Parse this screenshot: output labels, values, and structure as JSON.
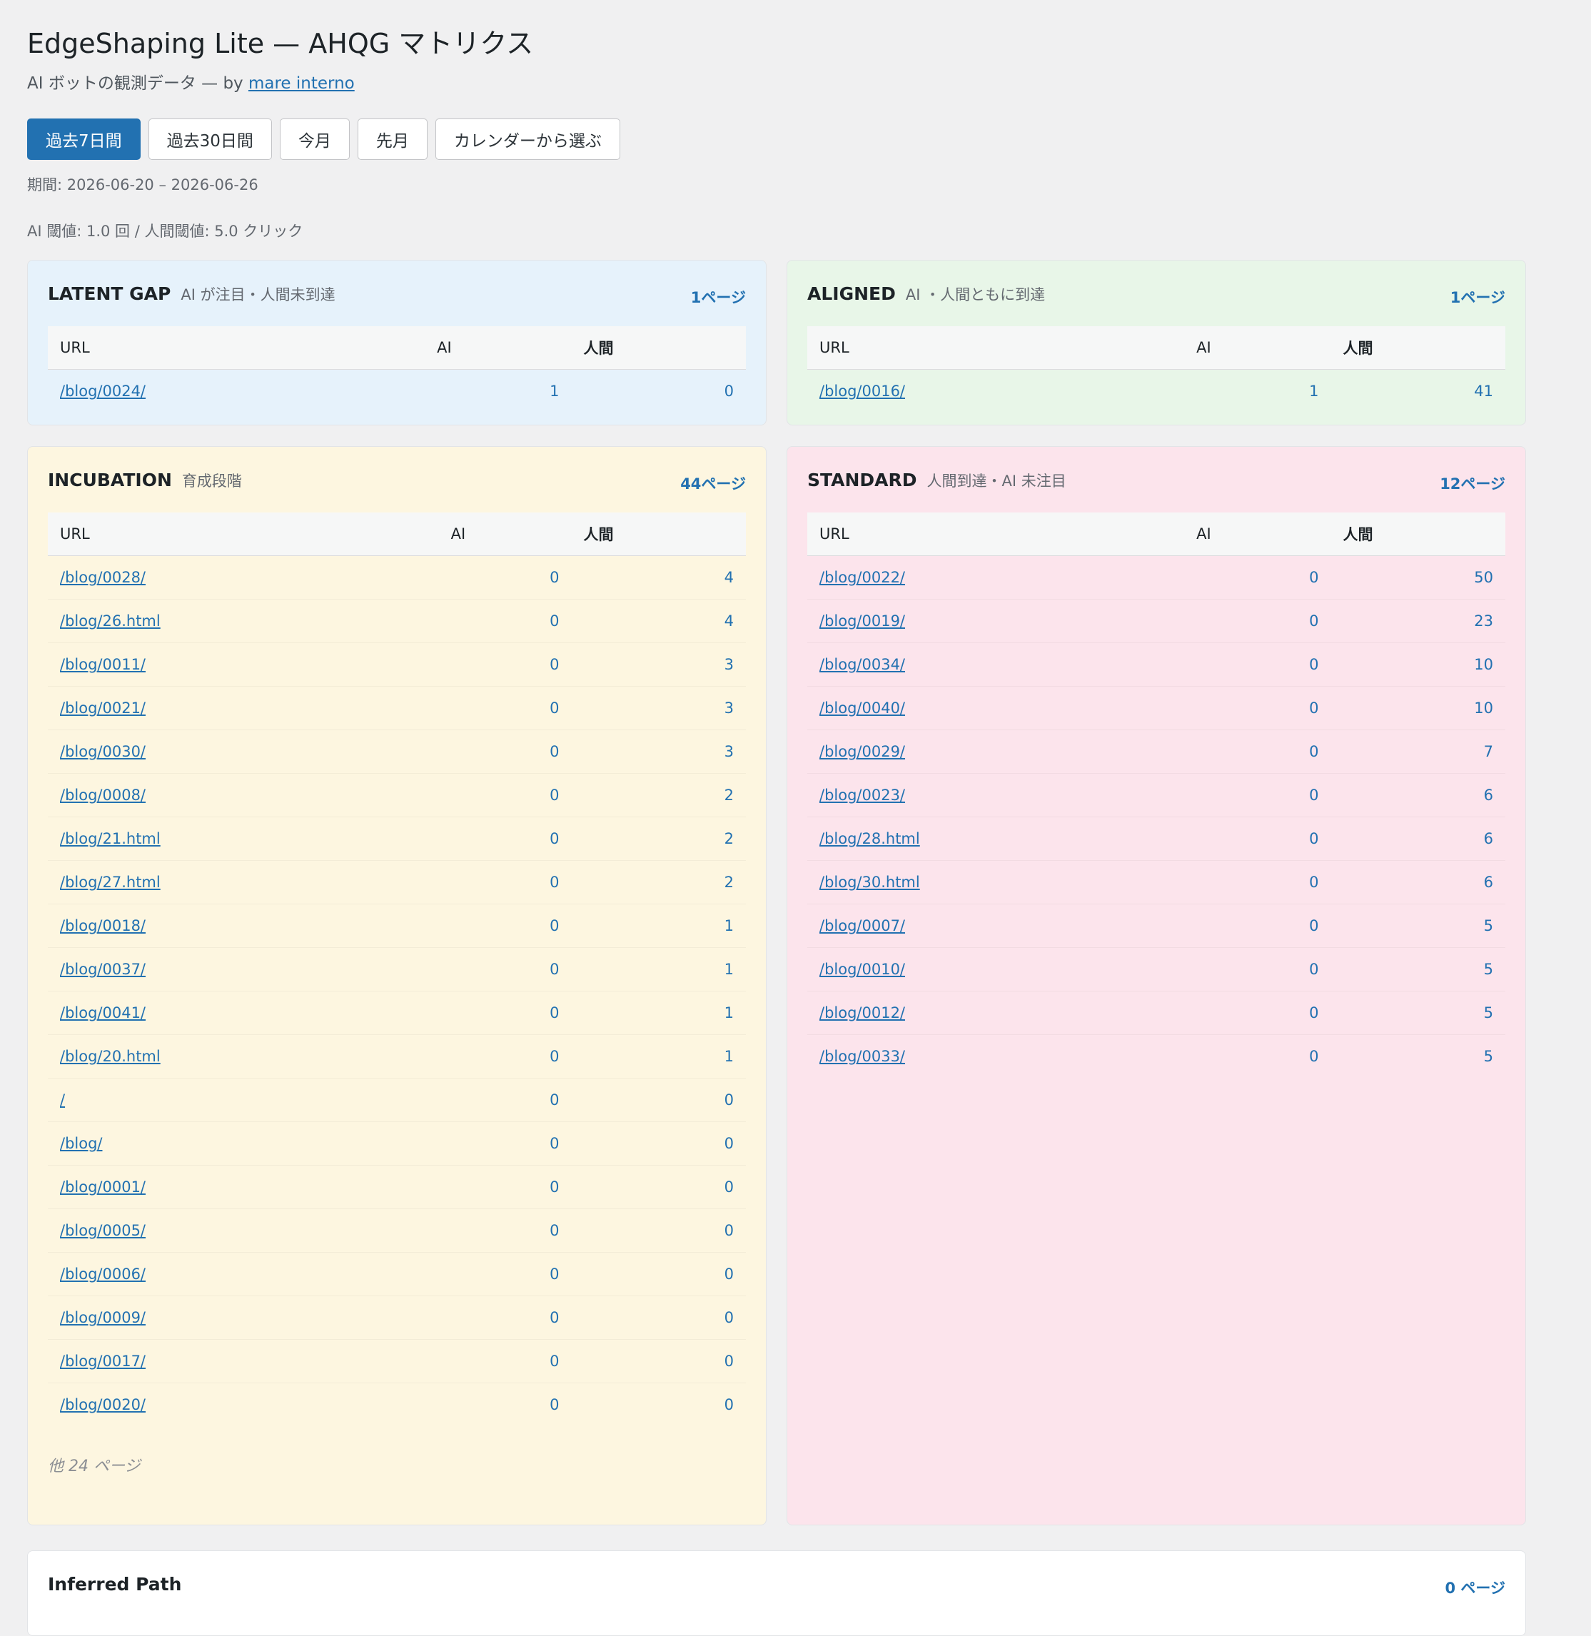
{
  "header": {
    "title": "EdgeShaping Lite — AHQG マトリクス",
    "subtitle_prefix": "AI ボットの観測データ — by ",
    "subtitle_link": "mare interno"
  },
  "ranges": {
    "buttons": [
      "過去7日間",
      "過去30日間",
      "今月",
      "先月",
      "カレンダーから選ぶ"
    ],
    "active_index": 0
  },
  "period_text": "期間: 2026-06-20 – 2026-06-26",
  "threshold_text": "AI 閾値: 1.0 回 / 人間閾値: 5.0 クリック",
  "table_headers": {
    "url": "URL",
    "ai": "AI",
    "human": "人間"
  },
  "colors": {
    "accent": "#2271b1",
    "latent_bg": "#e6f2fb",
    "aligned_bg": "#e8f6e8",
    "incubation_bg": "#fdf6e0",
    "standard_bg": "#fce4ec"
  },
  "quadrants": {
    "latent": {
      "name": "LATENT GAP",
      "desc": "AI が注目・人間未到達",
      "count": "1ページ",
      "rows": [
        {
          "url": "/blog/0024/",
          "ai": "1",
          "human": "0"
        }
      ]
    },
    "aligned": {
      "name": "ALIGNED",
      "desc": "AI ・人間ともに到達",
      "count": "1ページ",
      "rows": [
        {
          "url": "/blog/0016/",
          "ai": "1",
          "human": "41"
        }
      ]
    },
    "incubation": {
      "name": "INCUBATION",
      "desc": "育成段階",
      "count": "44ページ",
      "more": "他 24 ページ",
      "rows": [
        {
          "url": "/blog/0028/",
          "ai": "0",
          "human": "4"
        },
        {
          "url": "/blog/26.html",
          "ai": "0",
          "human": "4"
        },
        {
          "url": "/blog/0011/",
          "ai": "0",
          "human": "3"
        },
        {
          "url": "/blog/0021/",
          "ai": "0",
          "human": "3"
        },
        {
          "url": "/blog/0030/",
          "ai": "0",
          "human": "3"
        },
        {
          "url": "/blog/0008/",
          "ai": "0",
          "human": "2"
        },
        {
          "url": "/blog/21.html",
          "ai": "0",
          "human": "2"
        },
        {
          "url": "/blog/27.html",
          "ai": "0",
          "human": "2"
        },
        {
          "url": "/blog/0018/",
          "ai": "0",
          "human": "1"
        },
        {
          "url": "/blog/0037/",
          "ai": "0",
          "human": "1"
        },
        {
          "url": "/blog/0041/",
          "ai": "0",
          "human": "1"
        },
        {
          "url": "/blog/20.html",
          "ai": "0",
          "human": "1"
        },
        {
          "url": "/",
          "ai": "0",
          "human": "0"
        },
        {
          "url": "/blog/",
          "ai": "0",
          "human": "0"
        },
        {
          "url": "/blog/0001/",
          "ai": "0",
          "human": "0"
        },
        {
          "url": "/blog/0005/",
          "ai": "0",
          "human": "0"
        },
        {
          "url": "/blog/0006/",
          "ai": "0",
          "human": "0"
        },
        {
          "url": "/blog/0009/",
          "ai": "0",
          "human": "0"
        },
        {
          "url": "/blog/0017/",
          "ai": "0",
          "human": "0"
        },
        {
          "url": "/blog/0020/",
          "ai": "0",
          "human": "0"
        }
      ]
    },
    "standard": {
      "name": "STANDARD",
      "desc": "人間到達・AI 未注目",
      "count": "12ページ",
      "rows": [
        {
          "url": "/blog/0022/",
          "ai": "0",
          "human": "50"
        },
        {
          "url": "/blog/0019/",
          "ai": "0",
          "human": "23"
        },
        {
          "url": "/blog/0034/",
          "ai": "0",
          "human": "10"
        },
        {
          "url": "/blog/0040/",
          "ai": "0",
          "human": "10"
        },
        {
          "url": "/blog/0029/",
          "ai": "0",
          "human": "7"
        },
        {
          "url": "/blog/0023/",
          "ai": "0",
          "human": "6"
        },
        {
          "url": "/blog/28.html",
          "ai": "0",
          "human": "6"
        },
        {
          "url": "/blog/30.html",
          "ai": "0",
          "human": "6"
        },
        {
          "url": "/blog/0007/",
          "ai": "0",
          "human": "5"
        },
        {
          "url": "/blog/0010/",
          "ai": "0",
          "human": "5"
        },
        {
          "url": "/blog/0012/",
          "ai": "0",
          "human": "5"
        },
        {
          "url": "/blog/0033/",
          "ai": "0",
          "human": "5"
        }
      ]
    }
  },
  "inferred": {
    "name": "Inferred Path",
    "count": "0 ページ"
  }
}
